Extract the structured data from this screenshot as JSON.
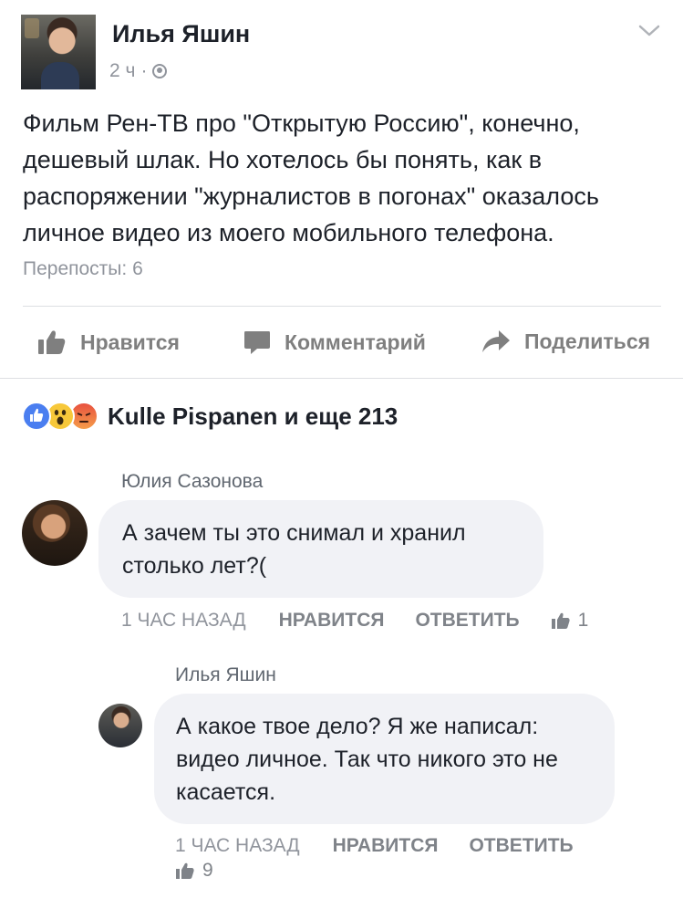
{
  "post": {
    "author": "Илья Яшин",
    "time": "2 ч",
    "separator": "·",
    "text": "Фильм Рен-ТВ про \"Открытую Россию\", конечно, дешевый шлак. Но хотелось бы понять, как в распоряжении \"журналистов в погонах\" оказалось личное видео из моего мобильного телефона.",
    "shares": "Перепосты: 6"
  },
  "actions": {
    "like": "Нравится",
    "comment": "Комментарий",
    "share": "Поделиться"
  },
  "reactions": {
    "summary": "Kulle Pispanen и еще 213"
  },
  "comments": [
    {
      "name": "Юлия Сазонова",
      "text": "А зачем ты это снимал и хранил столько лет?(",
      "time": "1 ЧАС НАЗАД",
      "like": "НРАВИТСЯ",
      "reply": "ОТВЕТИТЬ",
      "likes": "1"
    },
    {
      "name": "Илья Яшин",
      "text": "А какое твое дело? Я же написал: видео личное. Так что никого это не касается.",
      "time": "1 ЧАС НАЗАД",
      "like": "НРАВИТСЯ",
      "reply": "ОТВЕТИТЬ",
      "likes": "9"
    }
  ],
  "colors": {
    "text": "#1d2129",
    "muted": "#90949c",
    "bubble": "#f1f2f6",
    "like_blue": "#4a7ef0"
  }
}
